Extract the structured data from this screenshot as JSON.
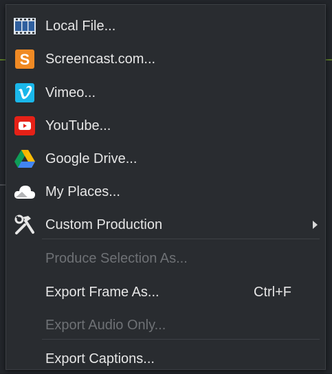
{
  "menu": {
    "items": [
      {
        "label": "Local File...",
        "icon": "film-strip-icon",
        "enabled": true
      },
      {
        "label": "Screencast.com...",
        "icon": "screencast-icon",
        "enabled": true
      },
      {
        "label": "Vimeo...",
        "icon": "vimeo-icon",
        "enabled": true
      },
      {
        "label": "YouTube...",
        "icon": "youtube-icon",
        "enabled": true
      },
      {
        "label": "Google Drive...",
        "icon": "google-drive-icon",
        "enabled": true
      },
      {
        "label": "My Places...",
        "icon": "cloud-icon",
        "enabled": true
      },
      {
        "label": "Custom Production",
        "icon": "tools-icon",
        "enabled": true,
        "submenu": true
      },
      {
        "label": "Produce Selection As...",
        "enabled": false
      },
      {
        "label": "Export Frame As...",
        "enabled": true,
        "shortcut": "Ctrl+F"
      },
      {
        "label": "Export Audio Only...",
        "enabled": false
      },
      {
        "label": "Export Captions...",
        "enabled": true
      }
    ]
  },
  "colors": {
    "menu_bg": "#292c30",
    "text": "#e6e6e6",
    "disabled_text": "#6e7175",
    "screencast_orange": "#f08a24",
    "vimeo_blue": "#1ab7ea",
    "youtube_red": "#e62117"
  }
}
